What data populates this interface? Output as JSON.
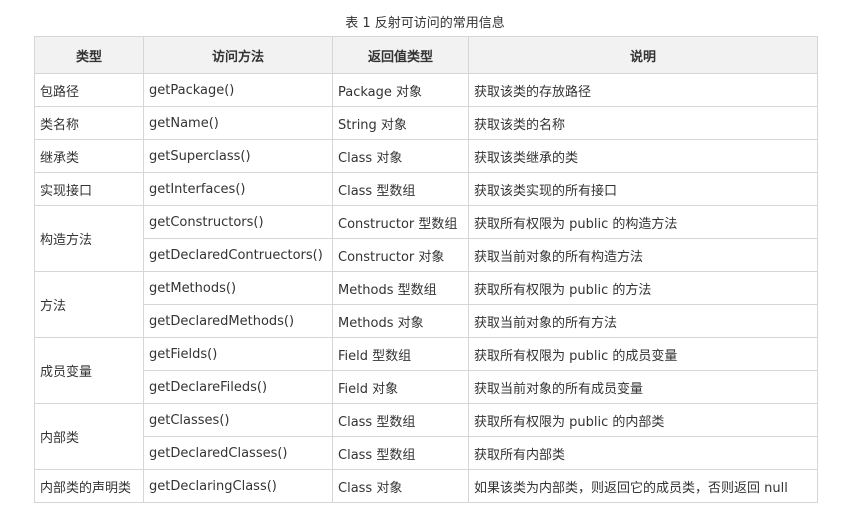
{
  "caption": "表 1 反射可访问的常用信息",
  "headers": [
    "类型",
    "访问方法",
    "返回值类型",
    "说明"
  ],
  "rows": [
    {
      "type": "包路径",
      "method": "getPackage()",
      "return": "Package 对象",
      "desc": "获取该类的存放路径"
    },
    {
      "type": "类名称",
      "method": "getName()",
      "return": "String 对象",
      "desc": "获取该类的名称"
    },
    {
      "type": "继承类",
      "method": "getSuperclass()",
      "return": "Class 对象",
      "desc": "获取该类继承的类"
    },
    {
      "type": "实现接口",
      "method": "getInterfaces()",
      "return": "Class 型数组",
      "desc": "获取该类实现的所有接口"
    },
    {
      "type": "构造方法",
      "method": "getConstructors()",
      "return": "Constructor 型数组",
      "desc": "获取所有权限为 public 的构造方法"
    },
    {
      "type": "",
      "method": "getDeclaredContruectors()",
      "return": "Constructor 对象",
      "desc": "获取当前对象的所有构造方法"
    },
    {
      "type": "方法",
      "method": "getMethods()",
      "return": "Methods 型数组",
      "desc": "获取所有权限为 public 的方法"
    },
    {
      "type": "",
      "method": "getDeclaredMethods()",
      "return": "Methods 对象",
      "desc": "获取当前对象的所有方法"
    },
    {
      "type": "成员变量",
      "method": "getFields()",
      "return": "Field 型数组",
      "desc": "获取所有权限为 public 的成员变量"
    },
    {
      "type": "",
      "method": "getDeclareFileds()",
      "return": "Field 对象",
      "desc": "获取当前对象的所有成员变量"
    },
    {
      "type": "内部类",
      "method": "getClasses()",
      "return": "Class 型数组",
      "desc": "获取所有权限为 public 的内部类"
    },
    {
      "type": "",
      "method": "getDeclaredClasses()",
      "return": "Class 型数组",
      "desc": "获取所有内部类"
    },
    {
      "type": "内部类的声明类",
      "method": "getDeclaringClass()",
      "return": "Class 对象",
      "desc": "如果该类为内部类，则返回它的成员类，否则返回 null"
    }
  ]
}
